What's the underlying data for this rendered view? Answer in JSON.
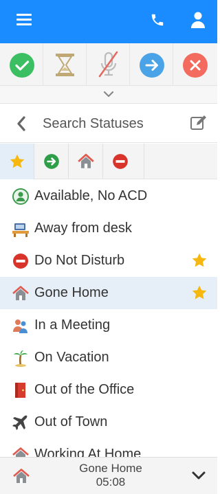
{
  "colors": {
    "topbar": "#1a8cff",
    "green": "#3cbf63",
    "blue": "#4aa3e6",
    "red": "#e64d43",
    "star": "#f6b80f"
  },
  "header": {
    "menu_icon": "hamburger-icon",
    "call_icon": "phone-icon",
    "user_icon": "user-icon"
  },
  "actions": [
    {
      "name": "available-action-button",
      "icon": "check-icon",
      "color": "#3cbf63"
    },
    {
      "name": "wrap-up-action-button",
      "icon": "hourglass-icon",
      "color": "#c9b37a"
    },
    {
      "name": "mute-action-button",
      "icon": "microphone-muted-icon",
      "color": "#e06b61"
    },
    {
      "name": "transfer-action-button",
      "icon": "arrow-right-icon",
      "color": "#4aa3e6"
    },
    {
      "name": "disconnect-action-button",
      "icon": "close-icon",
      "color": "#f36a5e"
    }
  ],
  "search": {
    "placeholder": "Search Statuses"
  },
  "filters": [
    {
      "name": "filter-favorites",
      "icon": "star-icon",
      "active": true
    },
    {
      "name": "filter-available",
      "icon": "arrow-circle-icon",
      "active": false
    },
    {
      "name": "filter-home",
      "icon": "home-icon",
      "active": false
    },
    {
      "name": "filter-dnd",
      "icon": "no-entry-icon",
      "active": false
    }
  ],
  "statuses": [
    {
      "label": "Available, No ACD",
      "icon": "person-available-icon",
      "favorite": false,
      "selected": false
    },
    {
      "label": "Away from desk",
      "icon": "computer-desk-icon",
      "favorite": false,
      "selected": false
    },
    {
      "label": "Do Not Disturb",
      "icon": "no-entry-icon",
      "favorite": true,
      "selected": false
    },
    {
      "label": "Gone Home",
      "icon": "home-icon",
      "favorite": true,
      "selected": true
    },
    {
      "label": "In a Meeting",
      "icon": "meeting-people-icon",
      "favorite": false,
      "selected": false
    },
    {
      "label": "On Vacation",
      "icon": "palm-tree-icon",
      "favorite": false,
      "selected": false
    },
    {
      "label": "Out of the Office",
      "icon": "door-icon",
      "favorite": false,
      "selected": false
    },
    {
      "label": "Out of Town",
      "icon": "airplane-icon",
      "favorite": false,
      "selected": false
    },
    {
      "label": "Working At Home",
      "icon": "home-icon",
      "favorite": false,
      "selected": false
    }
  ],
  "footer": {
    "status": "Gone Home",
    "time": "05:08",
    "icon": "home-icon"
  }
}
